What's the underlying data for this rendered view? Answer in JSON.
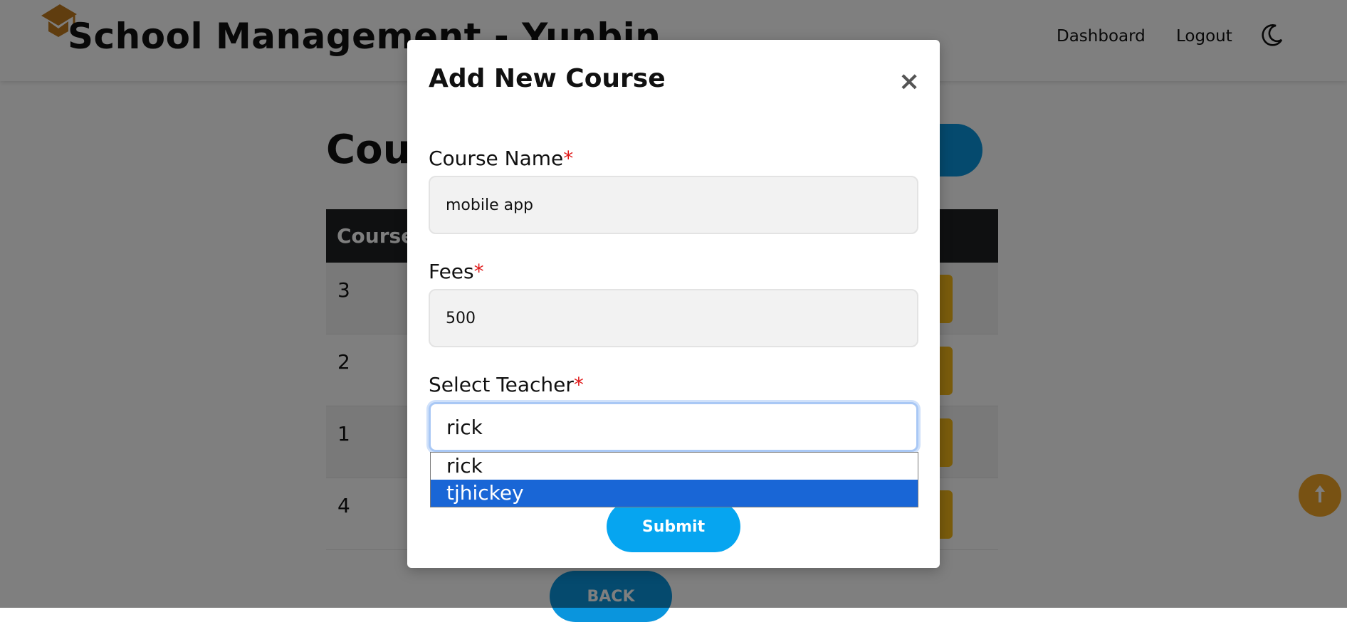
{
  "header": {
    "title": "School Management - Yunbin",
    "nav": {
      "dashboard": "Dashboard",
      "logout": "Logout"
    },
    "logo_icon": "graduation-cap-icon",
    "theme_icon": "moon-icon"
  },
  "page": {
    "heading": "Courses",
    "add_button_icon": "",
    "table": {
      "first_column_header": "Course",
      "rows": [
        {
          "id": "3"
        },
        {
          "id": "2"
        },
        {
          "id": "1"
        },
        {
          "id": "4"
        }
      ]
    },
    "back_label": "BACK"
  },
  "modal": {
    "title": "Add New Course",
    "close_symbol": "×",
    "required_marker": "*",
    "course_name": {
      "label": "Course Name",
      "value": "mobile app"
    },
    "fees": {
      "label": "Fees",
      "value": "500"
    },
    "teacher": {
      "label": "Select Teacher",
      "value": "rick",
      "options": [
        "rick",
        "tjhickey"
      ],
      "highlighted_option": "tjhickey"
    },
    "submit_label": "Submit"
  },
  "colors": {
    "accent_blue": "#06a5f0",
    "dropdown_highlight": "#1966d6",
    "required_red": "#e01b1b",
    "action_yellow": "#f4b819"
  }
}
